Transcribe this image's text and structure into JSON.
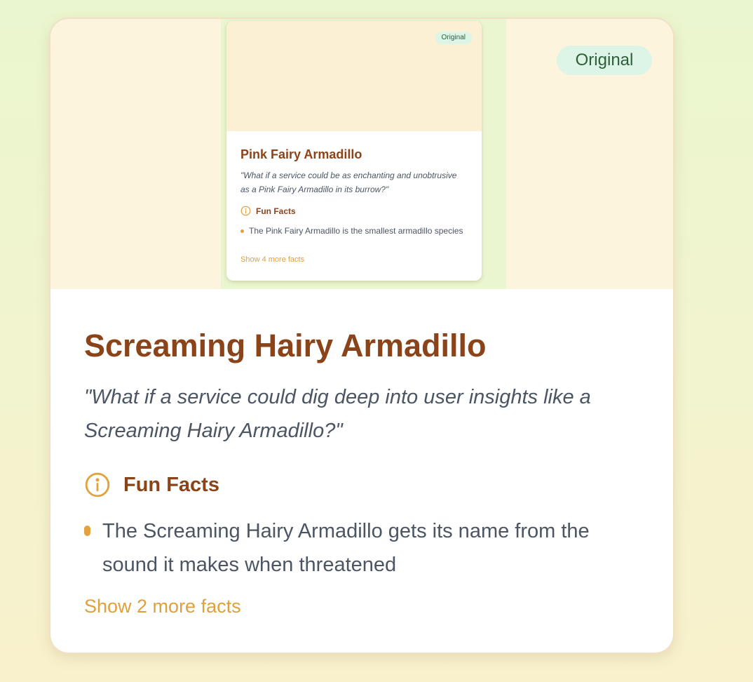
{
  "main_card": {
    "badge": "Original",
    "title": "Screaming Hairy Armadillo",
    "quote": "\"What if a service could dig deep into user insights like a Screaming Hairy Armadillo?\"",
    "facts_heading": "Fun Facts",
    "fact": "The Screaming Hairy Armadillo gets its name from the sound it makes when threatened",
    "more_link": "Show 2 more facts"
  },
  "preview_card": {
    "badge": "Original",
    "title": "Pink Fairy Armadillo",
    "quote": "\"What if a service could be as enchanting and unobtrusive as a Pink Fairy Armadillo in its burrow?\"",
    "facts_heading": "Fun Facts",
    "fact": "The Pink Fairy Armadillo is the smallest armadillo species",
    "more_link": "Show 4 more facts"
  },
  "colors": {
    "title": "#8b4419",
    "accent": "#e2a23c",
    "badge_bg": "#dcf5e6",
    "badge_text": "#2f5f3a",
    "body_text": "#4b5563"
  },
  "icons": {
    "facts_icon": "info-circle-icon",
    "fact_bullet": "bullet-dot-icon"
  }
}
